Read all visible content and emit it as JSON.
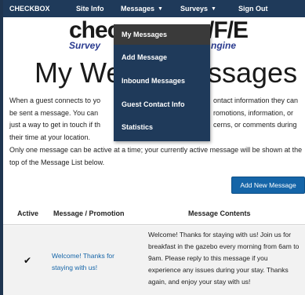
{
  "navbar": {
    "brand": "CHECKBOX",
    "items": [
      {
        "label": "Site Info"
      },
      {
        "label": "Messages",
        "has_caret": true
      },
      {
        "label": "Surveys",
        "has_caret": true
      },
      {
        "label": "Sign Out"
      }
    ],
    "bg_color": "#1f3a5a"
  },
  "logo": {
    "left_big": "chec",
    "left_sub": "Survey",
    "right_big": "/F/E",
    "right_sub": "ngine"
  },
  "page": {
    "title_left": "My Wel",
    "title_right": "ssages",
    "intro_lines": [
      "When a guest connects to yo",
      "be sent a message. You can",
      "just a way to get in touch if th",
      "their time at your location."
    ],
    "intro_lines_right": [
      "ontact information they can",
      "romotions, information, or",
      "cerns, or comments during"
    ],
    "note": "Only one message can be active at a time; your currently active message will be shown at the top of the Message List below.",
    "add_button": "Add New Message"
  },
  "table": {
    "headers": [
      "Active",
      "Message / Promotion",
      "Message Contents"
    ],
    "rows": [
      {
        "active_mark": "✔",
        "title": "Welcome! Thanks for staying with us!",
        "content": "Welcome! Thanks for staying with us! Join us for breakfast in the gazebo every morning from 6am to 9am. Please reply to this message if you experience any issues during your stay. Thanks again, and enjoy your stay with us!"
      }
    ]
  },
  "messages_menu": {
    "items": [
      {
        "label": "My Messages",
        "active": true
      },
      {
        "label": "Add Message"
      },
      {
        "label": "Inbound Messages"
      },
      {
        "label": "Guest Contact Info"
      },
      {
        "label": "Statistics"
      }
    ]
  },
  "colors": {
    "accent_blue": "#1565a8",
    "dark_navy": "#1f3a5a",
    "menu_active": "#3a3a3a"
  }
}
